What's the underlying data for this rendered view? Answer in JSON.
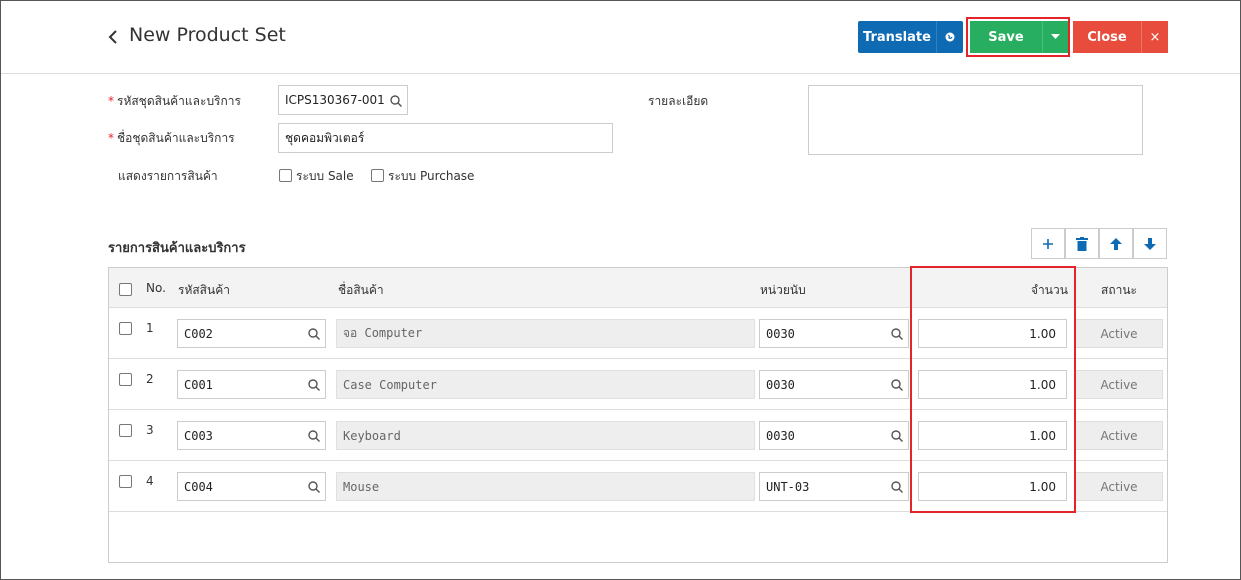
{
  "header": {
    "back_glyph": "<",
    "title": "New Product Set",
    "translate_label": "Translate",
    "save_label": "Save",
    "close_label": "Close",
    "close_x": "×"
  },
  "form": {
    "code_label": "รหัสชุดสินค้าและบริการ",
    "code_value": "ICPS130367-001",
    "name_label": "ชื่อชุดสินค้าและบริการ",
    "name_value": "ชุดคอมพิวเตอร์",
    "show_label": "แสดงรายการสินค้า",
    "sale_label": "ระบบ Sale",
    "purchase_label": "ระบบ Purchase",
    "detail_label": "รายละเอียด",
    "required_mark": "*"
  },
  "section": {
    "title": "รายการสินค้าและบริการ"
  },
  "table": {
    "headers": {
      "no": "No.",
      "code": "รหัสสินค้า",
      "name": "ชื่อสินค้า",
      "unit": "หน่วยนับ",
      "qty": "จำนวน",
      "status": "สถานะ"
    },
    "rows": [
      {
        "no": "1",
        "code": "C002",
        "name": "จอ Computer",
        "unit": "0030",
        "qty": "1.00",
        "status": "Active"
      },
      {
        "no": "2",
        "code": "C001",
        "name": "Case Computer",
        "unit": "0030",
        "qty": "1.00",
        "status": "Active"
      },
      {
        "no": "3",
        "code": "C003",
        "name": "Keyboard",
        "unit": "0030",
        "qty": "1.00",
        "status": "Active"
      },
      {
        "no": "4",
        "code": "C004",
        "name": "Mouse",
        "unit": "UNT-03",
        "qty": "1.00",
        "status": "Active"
      }
    ]
  },
  "colors": {
    "primary_blue": "#0f6ab4",
    "save_green": "#27ae60",
    "close_red": "#e74c3c",
    "highlight_red": "#e3242b"
  }
}
